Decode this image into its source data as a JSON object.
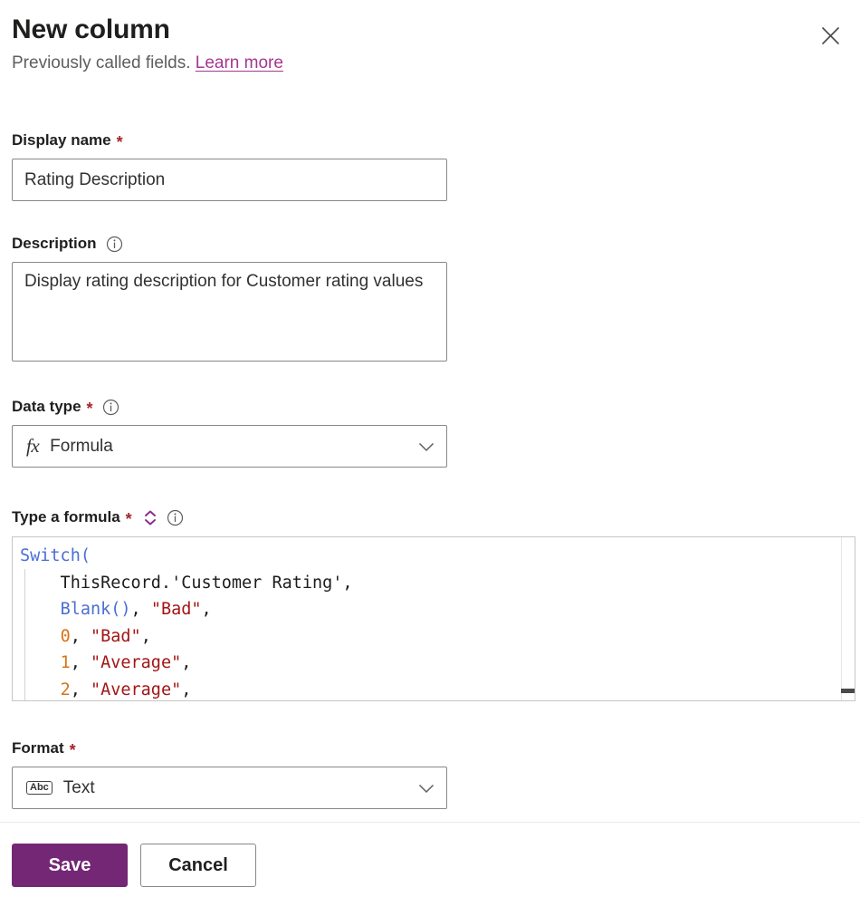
{
  "dialog": {
    "title": "New column",
    "subtitle_prefix": "Previously called fields.",
    "learn_more": "Learn more",
    "close_icon": "close-icon"
  },
  "fields": {
    "display_name": {
      "label": "Display name",
      "required_marker": "*",
      "value": "Rating Description",
      "placeholder": ""
    },
    "description": {
      "label": "Description",
      "info_icon": "info-icon",
      "value": "Display rating description for Customer rating values",
      "placeholder": ""
    },
    "data_type": {
      "label": "Data type",
      "required_marker": "*",
      "info_icon": "info-icon",
      "value": "Formula",
      "value_icon": "fx-icon",
      "chevron_icon": "chevron-down-icon"
    },
    "formula": {
      "label": "Type a formula",
      "required_marker": "*",
      "expand_icon": "expand-collapse-icon",
      "info_icon": "info-icon",
      "lines": [
        [
          {
            "t": "Switch(",
            "c": "fn"
          }
        ],
        [
          {
            "t": "    ThisRecord.'Customer Rating',",
            "c": "plain"
          }
        ],
        [
          {
            "t": "    ",
            "c": "plain"
          },
          {
            "t": "Blank()",
            "c": "fn"
          },
          {
            "t": ", ",
            "c": "plain"
          },
          {
            "t": "\"Bad\"",
            "c": "str"
          },
          {
            "t": ",",
            "c": "plain"
          }
        ],
        [
          {
            "t": "    ",
            "c": "plain"
          },
          {
            "t": "0",
            "c": "num"
          },
          {
            "t": ", ",
            "c": "plain"
          },
          {
            "t": "\"Bad\"",
            "c": "str"
          },
          {
            "t": ",",
            "c": "plain"
          }
        ],
        [
          {
            "t": "    ",
            "c": "plain"
          },
          {
            "t": "1",
            "c": "num"
          },
          {
            "t": ", ",
            "c": "plain"
          },
          {
            "t": "\"Average\"",
            "c": "str"
          },
          {
            "t": ",",
            "c": "plain"
          }
        ],
        [
          {
            "t": "    ",
            "c": "plain"
          },
          {
            "t": "2",
            "c": "num"
          },
          {
            "t": ", ",
            "c": "plain"
          },
          {
            "t": "\"Average\"",
            "c": "str"
          },
          {
            "t": ",",
            "c": "plain"
          }
        ]
      ]
    },
    "format": {
      "label": "Format",
      "required_marker": "*",
      "value": "Text",
      "value_icon": "abc-text-icon",
      "chevron_icon": "chevron-down-icon"
    }
  },
  "footer": {
    "save_label": "Save",
    "cancel_label": "Cancel"
  },
  "colors": {
    "primary_purple": "#742774",
    "link_purple": "#a4378f",
    "required_red": "#a4262c",
    "border_grey": "#8a8886",
    "token_function": "#4a6fd4",
    "token_number": "#d97316",
    "token_string": "#a31515"
  }
}
